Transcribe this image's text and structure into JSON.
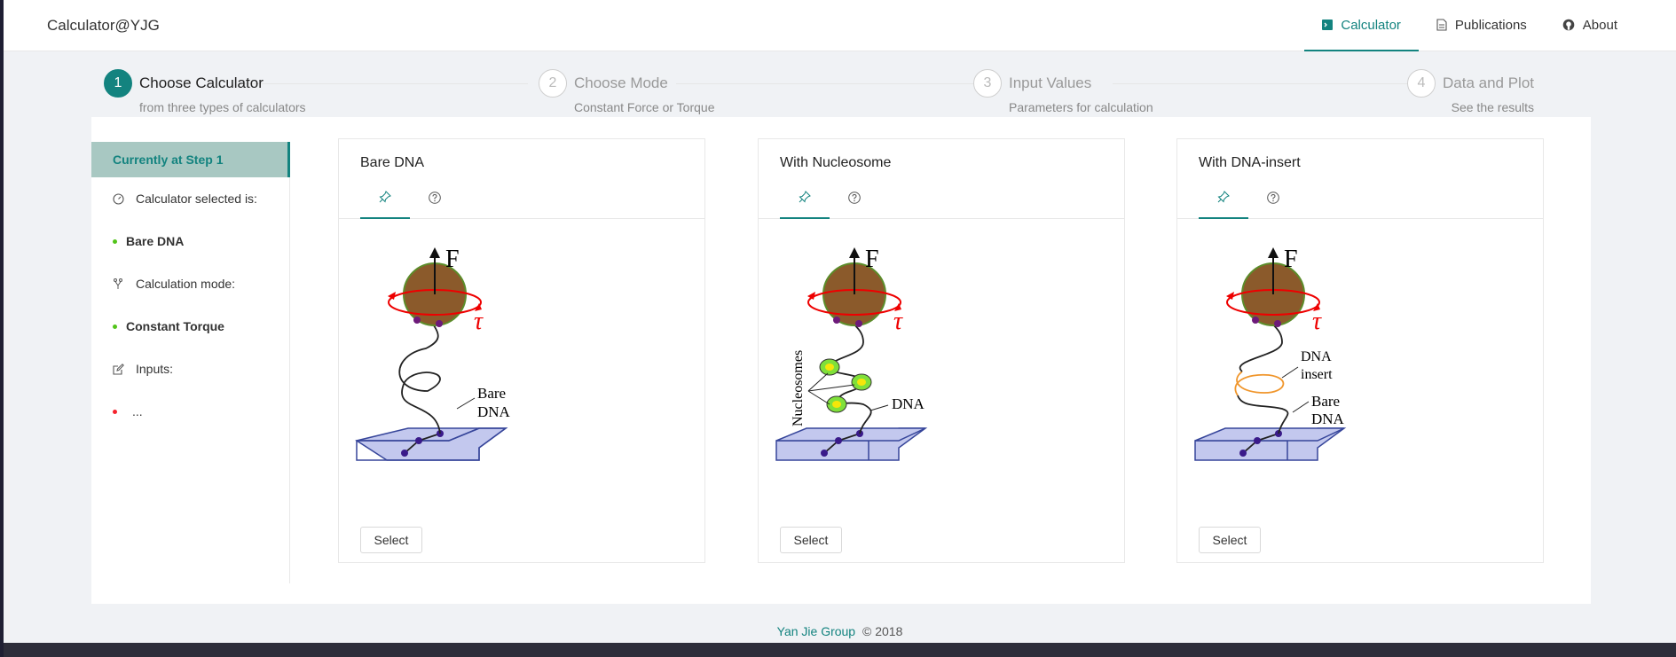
{
  "header": {
    "brand": "Calculator@YJG",
    "nav": [
      {
        "label": "Calculator",
        "icon": "terminal-icon",
        "active": true
      },
      {
        "label": "Publications",
        "icon": "document-icon",
        "active": false
      },
      {
        "label": "About",
        "icon": "github-icon",
        "active": false
      }
    ]
  },
  "steps": [
    {
      "num": "1",
      "title": "Choose Calculator",
      "desc": "from three types of calculators",
      "status": "active"
    },
    {
      "num": "2",
      "title": "Choose Mode",
      "desc": "Constant Force or Torque",
      "status": "wait"
    },
    {
      "num": "3",
      "title": "Input Values",
      "desc": "Parameters for calculation",
      "status": "wait"
    },
    {
      "num": "4",
      "title": "Data and Plot",
      "desc": "See the results",
      "status": "wait"
    }
  ],
  "sidebar": {
    "header": "Currently at Step 1",
    "calc_label": "Calculator selected is:",
    "calc_value": "Bare DNA",
    "mode_label": "Calculation mode:",
    "mode_value": "Constant Torque",
    "inputs_label": "Inputs:",
    "inputs_value": "..."
  },
  "cards": [
    {
      "title": "Bare DNA",
      "button": "Select",
      "figure": {
        "force": "F",
        "torque": "τ",
        "label1": "Bare",
        "label2": "DNA"
      }
    },
    {
      "title": "With Nucleosome",
      "button": "Select",
      "figure": {
        "force": "F",
        "torque": "τ",
        "label1": "DNA",
        "side_label": "Nucleosomes"
      }
    },
    {
      "title": "With DNA-insert",
      "button": "Select",
      "figure": {
        "force": "F",
        "torque": "τ",
        "insert1": "DNA",
        "insert2": "insert",
        "label1": "Bare",
        "label2": "DNA"
      }
    }
  ],
  "footer": {
    "link": "Yan Jie Group",
    "copyright": "© 2018"
  },
  "colors": {
    "accent": "#13837f",
    "sidebar_header_bg": "#a8c8c2",
    "bead": "#8b5a2b",
    "surface": "#c3c8ee",
    "insert": "#f0962c",
    "nucleosome": "#7fe03a"
  }
}
